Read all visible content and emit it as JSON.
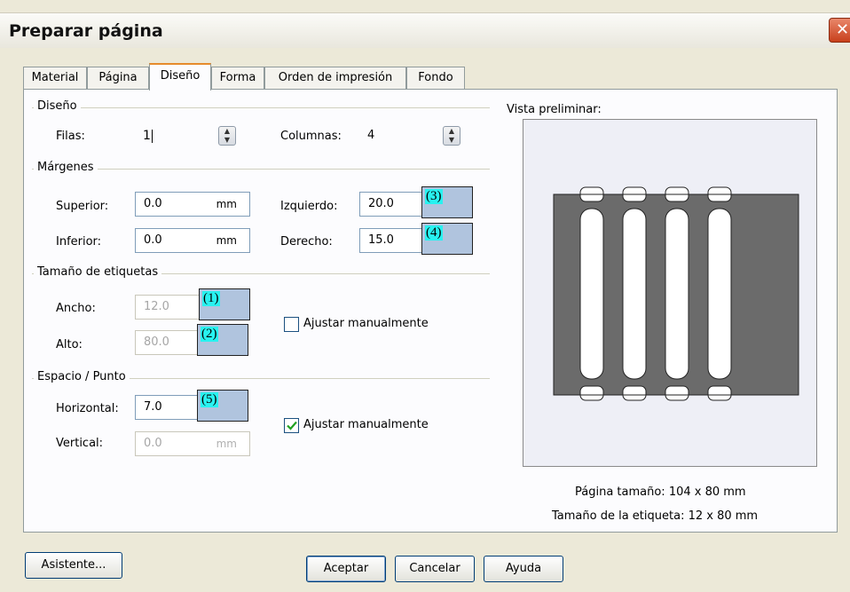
{
  "window": {
    "title": "Preparar página",
    "close_glyph": "✕"
  },
  "tabs": [
    "Material",
    "Página",
    "Diseño",
    "Forma",
    "Orden de impresión",
    "Fondo"
  ],
  "active_tab_index": 2,
  "layout_group": {
    "title": "Diseño",
    "rows_label": "Filas:",
    "rows_value": "1",
    "columns_label": "Columnas:",
    "columns_value": "4"
  },
  "margins_group": {
    "title": "Márgenes",
    "top_label": "Superior:",
    "top_value": "0.0",
    "top_unit": "mm",
    "bottom_label": "Inferior:",
    "bottom_value": "0.0",
    "bottom_unit": "mm",
    "left_label": "Izquierdo:",
    "left_value": "20.0",
    "left_marker": "(3)",
    "right_label": "Derecho:",
    "right_value": "15.0",
    "right_marker": "(4)"
  },
  "label_size_group": {
    "title": "Tamaño de etiquetas",
    "width_label": "Ancho:",
    "width_value": "12.0",
    "width_marker": "(1)",
    "height_label": "Alto:",
    "height_value": "80.0",
    "height_marker": "(2)",
    "manual_label": "Ajustar manualmente",
    "manual_checked": false
  },
  "spacing_group": {
    "title": "Espacio / Punto",
    "horizontal_label": "Horizontal:",
    "horizontal_value": "7.0",
    "horizontal_marker": "(5)",
    "vertical_label": "Vertical:",
    "vertical_value": "0.0",
    "vertical_unit": "mm",
    "manual_label": "Ajustar manualmente",
    "manual_checked": true
  },
  "preview": {
    "title": "Vista preliminar:",
    "page_size_text": "Página tamaño:  104 x 80  mm",
    "label_size_text": "Tamaño de la etiqueta:  12 x 80  mm",
    "label_columns": 4
  },
  "buttons": {
    "wizard": "Asistente...",
    "ok": "Aceptar",
    "cancel": "Cancelar",
    "help": "Ayuda"
  },
  "colors": {
    "marker_fill": "#b0c4de",
    "marker_text_bg": "#28f2f0",
    "preview_page": "#6b6b6b",
    "tab_highlight": "#e68b2c"
  }
}
